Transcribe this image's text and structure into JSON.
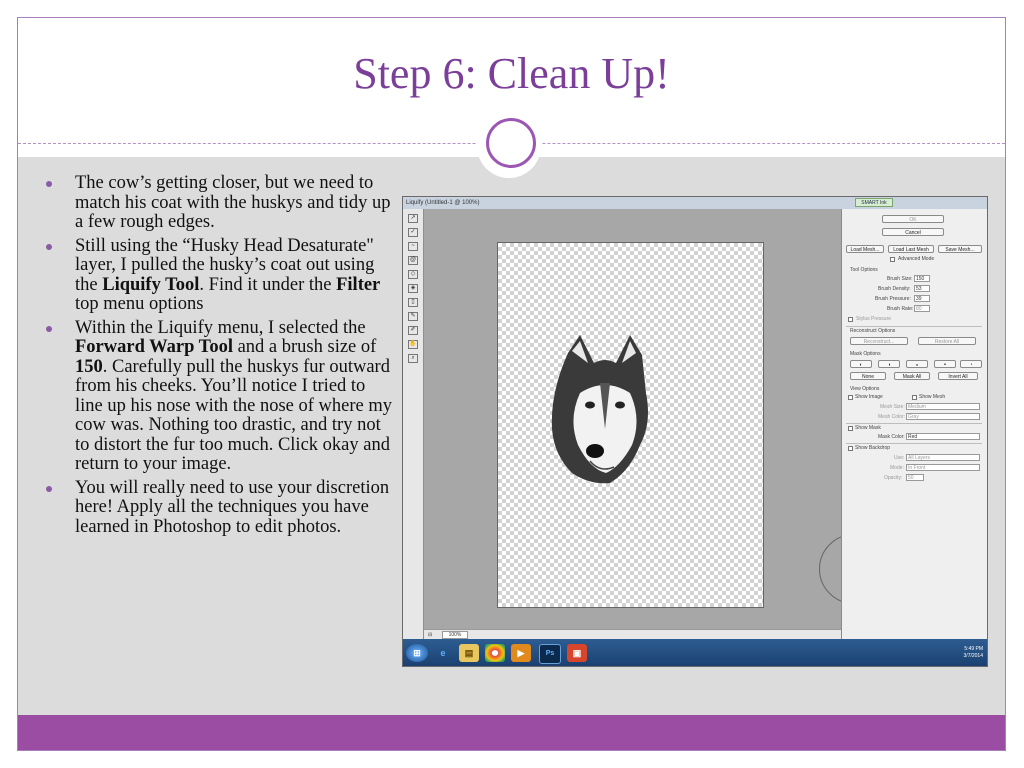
{
  "slide": {
    "title": "Step 6: Clean Up!",
    "bullets": [
      {
        "parts": [
          {
            "t": "The cow’s getting closer, but we need to match his coat with the huskys and tidy up a few rough edges.",
            "b": false
          }
        ]
      },
      {
        "parts": [
          {
            "t": "Still using the “Husky Head Desaturate\" layer, I pulled the husky’s coat out using the ",
            "b": false
          },
          {
            "t": "Liquify Tool",
            "b": true
          },
          {
            "t": ". Find it under the ",
            "b": false
          },
          {
            "t": "Filter",
            "b": true
          },
          {
            "t": " top menu options",
            "b": false
          }
        ]
      },
      {
        "parts": [
          {
            "t": "Within the Liquify menu, I selected the ",
            "b": false
          },
          {
            "t": "Forward Warp Tool",
            "b": true
          },
          {
            "t": " and a brush size of ",
            "b": false
          },
          {
            "t": "150",
            "b": true
          },
          {
            "t": ". Carefully pull the huskys fur outward from his cheeks.  You’ll notice I tried to line up his nose with the nose of where my cow was.  Nothing too drastic, and try not to distort the fur too much. Click okay and return to your image.",
            "b": false
          }
        ]
      },
      {
        "parts": [
          {
            "t": "You will really need to use your discretion here!  Apply all the techniques you have learned in Photoshop to edit photos.",
            "b": false
          }
        ]
      }
    ]
  },
  "screenshot": {
    "window_title": "Liquify (Untitled-1 @ 100%)",
    "smart_ink": "SMART Ink",
    "zoom": "100%",
    "buttons": {
      "ok": "OK",
      "cancel": "Cancel",
      "load_mesh": "Load Mesh...",
      "load_last_mesh": "Load Last Mesh",
      "save_mesh": "Save Mesh...",
      "reconstruct": "Reconstruct...",
      "restore_all": "Restore All",
      "none": "None",
      "mask_all": "Mask All",
      "invert_all": "Invert All"
    },
    "advanced_mode": "Advanced Mode",
    "tool_options": {
      "heading": "Tool Options",
      "brush_size_label": "Brush Size:",
      "brush_size": "150",
      "brush_density_label": "Brush Density:",
      "brush_density": "53",
      "brush_pressure_label": "Brush Pressure:",
      "brush_pressure": "39",
      "brush_rate_label": "Brush Rate:",
      "brush_rate": "80",
      "stylus_pressure": "Stylus Pressure"
    },
    "reconstruct_options": "Reconstruct Options",
    "mask_options": "Mask Options",
    "view_options": {
      "heading": "View Options",
      "show_image": "Show Image",
      "show_mesh": "Show Mesh",
      "mesh_size_label": "Mesh Size:",
      "mesh_size": "Medium",
      "mesh_color_label": "Mesh Color:",
      "mesh_color": "Gray",
      "show_mask": "Show Mask",
      "mask_color_label": "Mask Color:",
      "mask_color": "Red",
      "show_backdrop": "Show Backdrop",
      "use_label": "Use:",
      "use": "All Layers",
      "mode_label": "Mode:",
      "mode": "In Front",
      "opacity_label": "Opacity:",
      "opacity": "50"
    },
    "taskbar": {
      "ps_label": "Ps",
      "time": "5:49 PM",
      "date": "3/7/2014"
    }
  },
  "colors": {
    "accent": "#7b3f99",
    "footer": "#9b4ca3",
    "content_bg": "#dcdcdc"
  }
}
